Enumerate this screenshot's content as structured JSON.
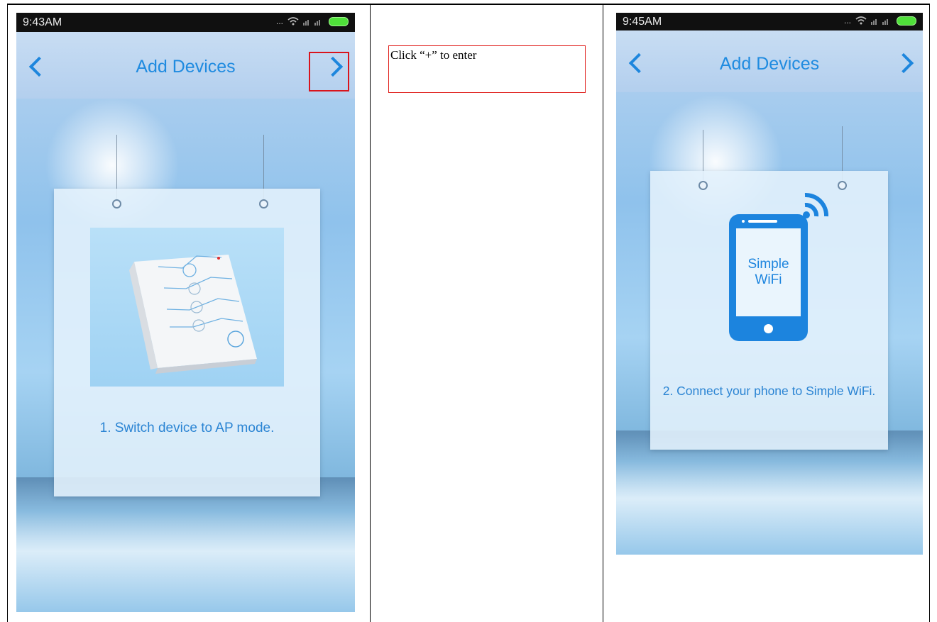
{
  "left_phone": {
    "status_time": "9:43AM",
    "status_icons": "...",
    "title": "Add Devices",
    "step_caption": "1. Switch device to AP mode."
  },
  "middle_note": {
    "callout_text": "Click “+” to enter"
  },
  "right_phone": {
    "status_time": "9:45AM",
    "status_icons": "...",
    "title": "Add Devices",
    "screen_text_line1": "Simple",
    "screen_text_line2": "WiFi",
    "step_caption": "2. Connect your phone to Simple WiFi."
  },
  "colors": {
    "accent": "#1f8be0",
    "highlight": "#d9141c"
  },
  "icons": [
    "back-chevron-icon",
    "forward-chevron-icon",
    "wifi-icon",
    "signal-icon",
    "battery-icon",
    "phone-icon",
    "wifi-signal-icon",
    "router-device-icon"
  ]
}
